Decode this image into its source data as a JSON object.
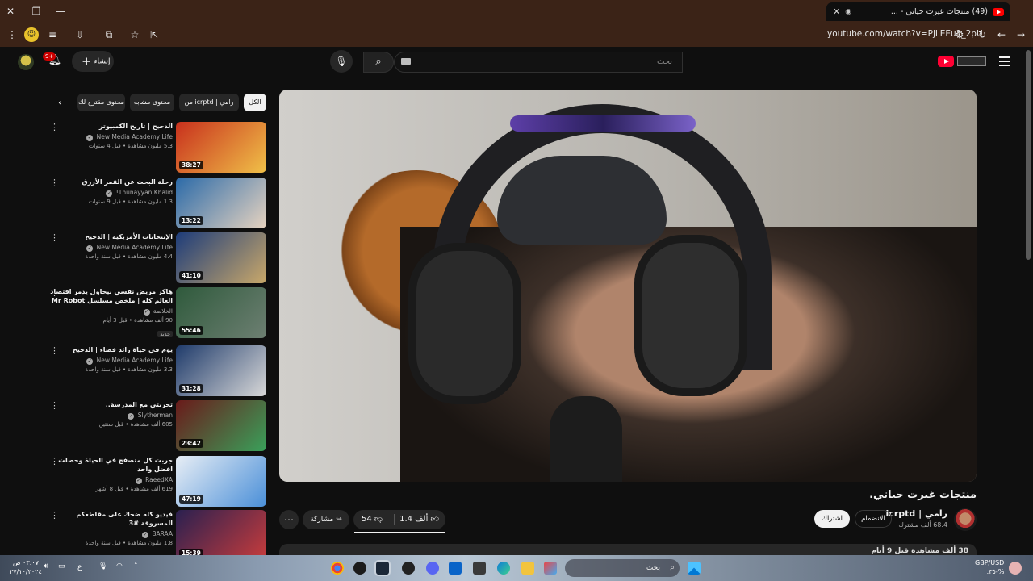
{
  "browser": {
    "tab_title": "(49) منتجات غيرت حياتي - ...",
    "url": "youtube.com/watch?v=PjLEEu1_2pU",
    "window_controls": [
      "close",
      "restore",
      "minimize"
    ]
  },
  "header": {
    "search_placeholder": "بحث",
    "create_label": "إنشاء",
    "notifications_badge": "9+"
  },
  "video": {
    "title": "منتجات غيرت حياتي.",
    "channel_name": "رامي | icrptd",
    "subscribers": "68.4 ألف مشترك",
    "join_label": "الانضمام",
    "subscribe_label": "اشتراك",
    "likes": "1.4 ألف",
    "dislikes": "54",
    "share_label": "مشاركة",
    "description_preview": "38 ألف مشاهدة قبل 9 أيام"
  },
  "chips": [
    "الكل",
    "من icrptd | رامي",
    "محتوى مشابه",
    "محتوى مقترح لك"
  ],
  "recommendations": [
    {
      "title": "الدحيح | تاريخ الكمبيوتر",
      "channel": "New Media Academy Life",
      "meta": "5.3 مليون مشاهدة • قبل 4 سنوات",
      "duration": "38:27",
      "colors": [
        "#c8301d",
        "#f0c048"
      ]
    },
    {
      "title": "رحلة البحث عن القمر الأزرق",
      "channel": "Thunayyan Khalid!",
      "meta": "1.3 مليون مشاهدة • قبل 9 سنوات",
      "duration": "13:22",
      "colors": [
        "#2b6aa8",
        "#e6d3c0"
      ]
    },
    {
      "title": "الإنتخابات الأمريكية | الدحيح",
      "channel": "New Media Academy Life",
      "meta": "4.4 مليون مشاهدة • قبل سنة واحدة",
      "duration": "41:10",
      "colors": [
        "#1d3c7a",
        "#c9a86a"
      ]
    },
    {
      "title": "هاكر مريض نفسي بيحاول يدمر اقتصاد العالم كله | ملخص مسلسل Mr Robot",
      "channel": "الخلاصة",
      "meta": "90 ألف مشاهدة • قبل 3 أيام",
      "badge": "جديد",
      "duration": "55:46",
      "colors": [
        "#2f5a3c",
        "#6d7f72"
      ]
    },
    {
      "title": "يوم في حياة رائد فضاء | الدحيح",
      "channel": "New Media Academy Life",
      "meta": "3.3 مليون مشاهدة • قبل سنة واحدة",
      "duration": "31:28",
      "colors": [
        "#1f3b6b",
        "#d8d8d8"
      ]
    },
    {
      "title": "تجربتي مع المدرسة..",
      "channel": "Slytherman",
      "meta": "605 ألف مشاهدة • قبل سنتين",
      "duration": "23:42",
      "colors": [
        "#6a1a1a",
        "#3aa05a"
      ]
    },
    {
      "title": "جربت كل متصفح في الحياة وحصلت افضل واحد",
      "channel": "RaeedXA",
      "meta": "619 ألف مشاهدة • قبل 8 أشهر",
      "duration": "47:19",
      "colors": [
        "#e8eef5",
        "#4a8fd8"
      ]
    },
    {
      "title": "فيديو كله ضحك على مقاطعكم المسروقة #3",
      "channel": "BARAA",
      "meta": "1.8 مليون مشاهدة • قبل سنة واحدة",
      "duration": "15:39",
      "colors": [
        "#2a2050",
        "#c83c3c"
      ]
    }
  ],
  "taskbar": {
    "search_placeholder": "بحث",
    "clock_time": "٠٣:٠٧ ص",
    "clock_date": "٢٧/١٠/٢٠٢٤",
    "fx_pair": "GBP/USD",
    "fx_change": "٠.٣٥-%",
    "language": "ع"
  }
}
